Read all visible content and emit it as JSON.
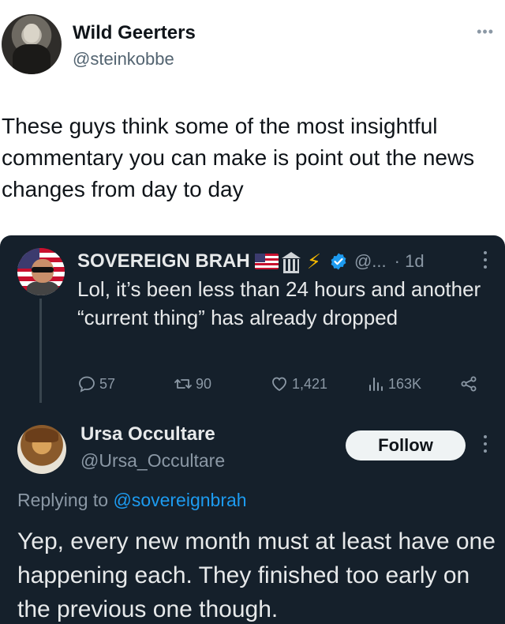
{
  "outer_tweet": {
    "author_name": "Wild Geerters",
    "author_handle": "@steinkobbe",
    "more_label": "•••",
    "text": "These guys think some of the most insightful commentary you can make is point out the news changes from day to day"
  },
  "quoted_reply": {
    "author_name": "SOVEREIGN BRAH",
    "handle": "@...",
    "time": "· 1d",
    "text": "Lol, it’s been less than 24 hours and another “current thing” has already dropped",
    "actions": {
      "reply_count": "57",
      "retweet_count": "90",
      "like_count": "1,421",
      "views_count": "163K"
    },
    "icons": [
      "us-flag-emoji",
      "bank-emoji",
      "lightning-emoji",
      "verified-icon",
      "more-icon",
      "reply-icon",
      "retweet-icon",
      "like-icon",
      "views-icon",
      "share-icon"
    ]
  },
  "reply": {
    "author_name": "Ursa Occultare",
    "author_handle": "@Ursa_Occultare",
    "follow_label": "Follow",
    "replying_prefix": "Replying to",
    "replying_to": "@sovereignbrah",
    "text": "Yep, every new month must at least have one happening each. They finished too early on the previous one though."
  },
  "colors": {
    "dark_bg": "#15202b",
    "text_light": "#e7e9ea",
    "text_muted": "#8b98a5",
    "link_blue": "#1d9bf0",
    "bolt_yellow": "#f5b700"
  }
}
